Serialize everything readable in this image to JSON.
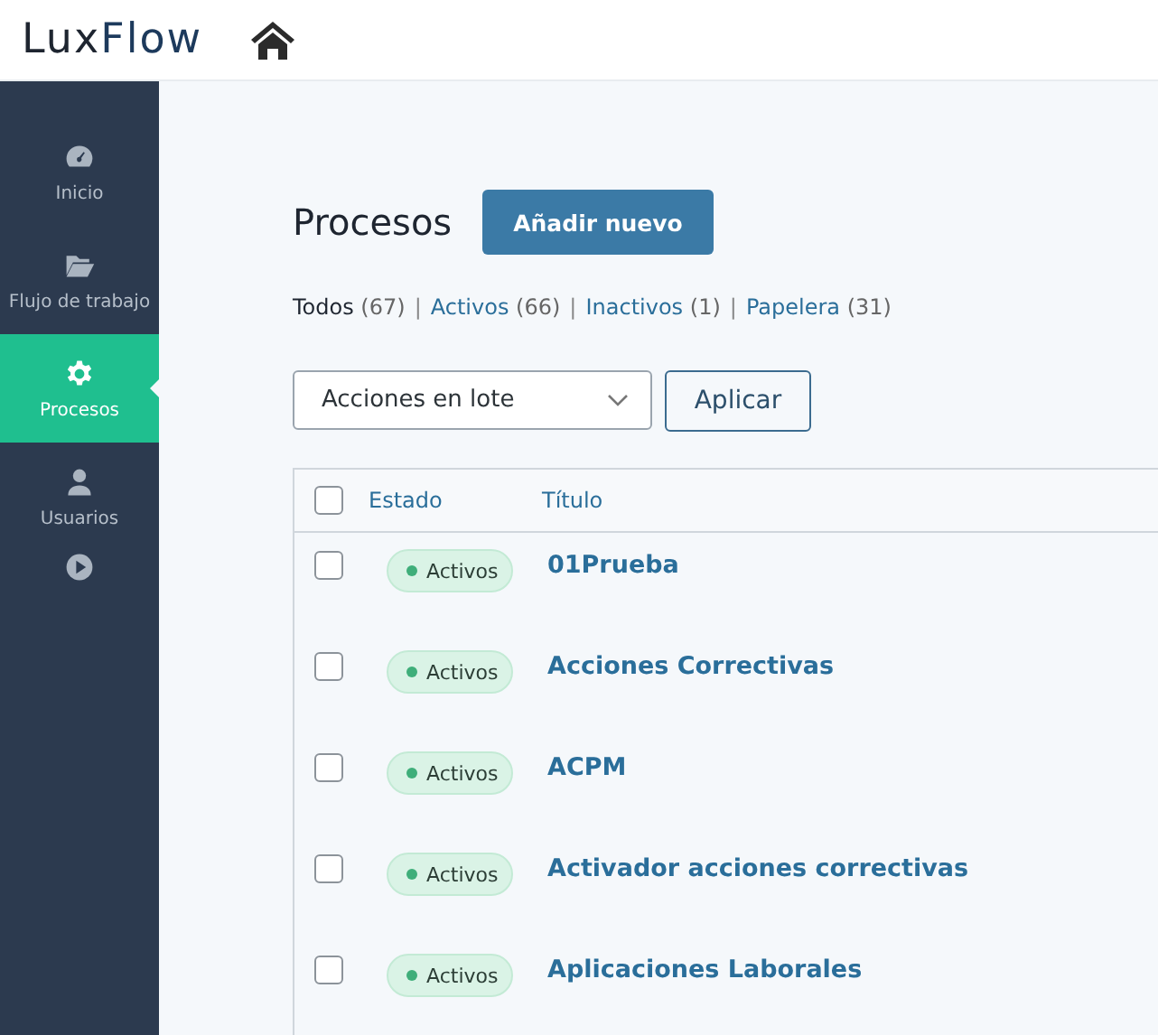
{
  "header": {
    "logo_prefix": "Lux",
    "logo_suffix": "Flow"
  },
  "sidebar": {
    "items": [
      {
        "label": "Inicio",
        "selected": false
      },
      {
        "label": "Flujo de trabajo",
        "selected": false
      },
      {
        "label": "Procesos",
        "selected": true
      },
      {
        "label": "Usuarios",
        "selected": false
      },
      {
        "selected": false
      }
    ]
  },
  "page": {
    "title": "Procesos",
    "add_button": "Añadir nuevo"
  },
  "filter_separator": "|",
  "filters": [
    {
      "label": "Todos",
      "count": "(67)",
      "selected": true
    },
    {
      "label": "Activos",
      "count": "(66)",
      "selected": false
    },
    {
      "label": "Inactivos",
      "count": "(1)",
      "selected": false
    },
    {
      "label": "Papelera",
      "count": "(31)",
      "selected": false
    }
  ],
  "bulk": {
    "select": "Acciones en lote",
    "apply": "Aplicar"
  },
  "table": {
    "columns": [
      "Estado",
      "Título"
    ],
    "header_checked": false,
    "rows": [
      {
        "checked": false,
        "status": "Activos",
        "title": "01Prueba"
      },
      {
        "checked": false,
        "status": "Activos",
        "title": "Acciones Correctivas"
      },
      {
        "checked": false,
        "status": "Activos",
        "title": "ACPM"
      },
      {
        "checked": false,
        "status": "Activos",
        "title": "Activador acciones correctivas"
      },
      {
        "checked": false,
        "status": "Activos",
        "title": "Aplicaciones Laborales"
      }
    ]
  }
}
